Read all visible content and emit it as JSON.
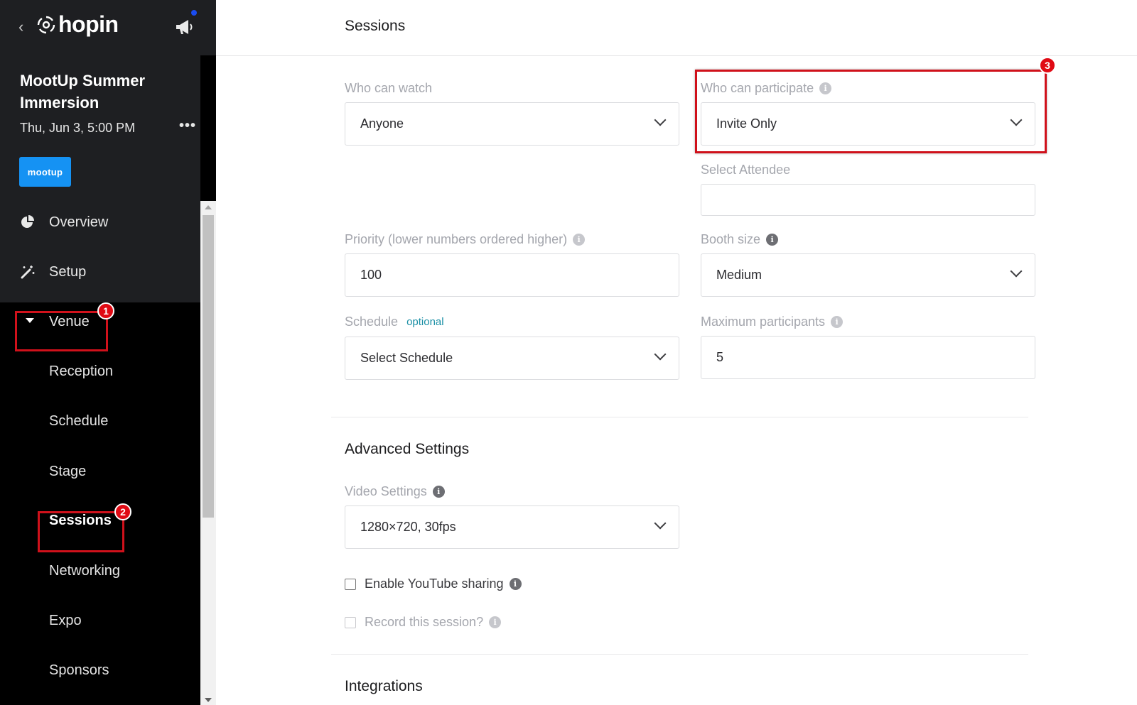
{
  "sidebar": {
    "back_glyph": "‹",
    "logo_text": "hopin",
    "event_title": "MootUp Summer Immersion",
    "event_date": "Thu, Jun 3, 5:00 PM",
    "more_glyph": "•••",
    "org_logo_text": "mootup",
    "nav": {
      "overview": "Overview",
      "setup": "Setup",
      "venue": "Venue",
      "reception": "Reception",
      "schedule": "Schedule",
      "stage": "Stage",
      "sessions": "Sessions",
      "networking": "Networking",
      "expo": "Expo",
      "sponsors": "Sponsors"
    },
    "active_item": "Sessions"
  },
  "annotations": {
    "badge1": "1",
    "badge2": "2",
    "badge3": "3",
    "color": "#d0111b"
  },
  "main": {
    "page_title": "Sessions",
    "who_can_watch": {
      "label": "Who can watch",
      "value": "Anyone"
    },
    "who_can_participate": {
      "label": "Who can participate",
      "value": "Invite Only"
    },
    "select_attendee": {
      "label": "Select Attendee",
      "value": ""
    },
    "priority": {
      "label": "Priority (lower numbers ordered higher)",
      "value": "100"
    },
    "booth_size": {
      "label": "Booth size",
      "value": "Medium"
    },
    "schedule": {
      "label": "Schedule",
      "optional": "optional",
      "value": "Select Schedule"
    },
    "max_participants": {
      "label": "Maximum participants",
      "value": "5"
    },
    "advanced_title": "Advanced Settings",
    "video_settings": {
      "label": "Video Settings",
      "value": "1280×720, 30fps"
    },
    "youtube_sharing": {
      "label": "Enable YouTube sharing",
      "checked": false
    },
    "record_session": {
      "label": "Record this session?",
      "checked": false,
      "disabled": true
    },
    "integrations_title": "Integrations"
  },
  "icons": {
    "info": "i",
    "overview": "pie-chart-icon",
    "setup": "magic-wand-icon",
    "notifications": "megaphone-icon"
  },
  "colors": {
    "sidebar_bg": "#000000",
    "sidebar_panel": "#1e1f22",
    "org_logo": "#1592f3",
    "optional_text": "#1a8fa5",
    "notification_dot": "#1a4cf0"
  }
}
